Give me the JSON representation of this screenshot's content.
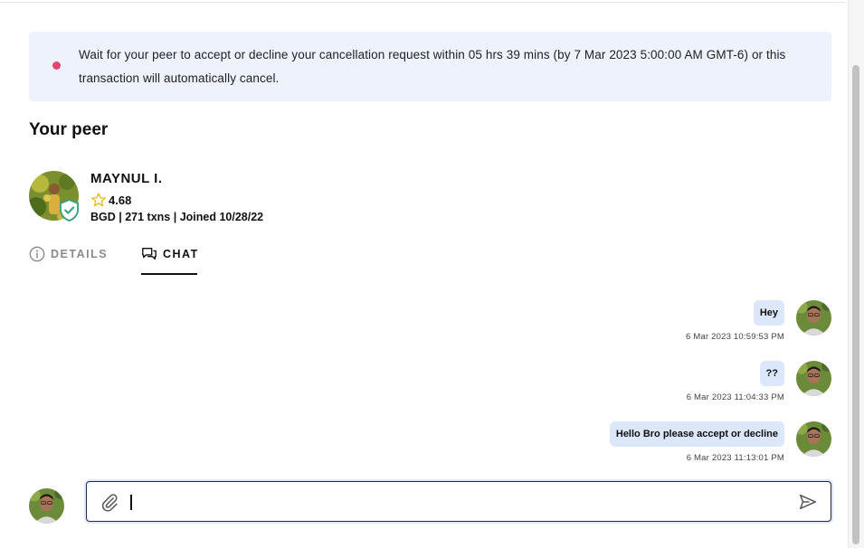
{
  "notice": {
    "text": "Wait for your peer to accept or decline your cancellation request within 05 hrs 39 mins (by 7 Mar 2023 5:00:00 AM GMT-6) or this transaction will automatically cancel.",
    "dot_color": "#e0466e"
  },
  "peer": {
    "heading": "Your peer",
    "name": "MAYNUL I.",
    "rating": "4.68",
    "stats": "BGD | 271 txns | Joined 10/28/22",
    "verified_icon": "shield-check-icon"
  },
  "tabs": [
    {
      "label": "DETAILS",
      "icon": "info-icon",
      "active": false
    },
    {
      "label": "CHAT",
      "icon": "chat-bubbles-icon",
      "active": true
    }
  ],
  "messages": [
    {
      "text": "Hey",
      "time": "6 Mar 2023 10:59:53 PM"
    },
    {
      "text": "??",
      "time": "6 Mar 2023 11:04:33 PM"
    },
    {
      "text": "Hello Bro please accept or decline",
      "time": "6 Mar 2023 11:13:01 PM"
    }
  ],
  "composer": {
    "value": "",
    "placeholder": "",
    "attach_icon": "paperclip-icon",
    "send_icon": "send-icon"
  },
  "colors": {
    "notice_bg": "#edf2fc",
    "bubble_bg": "#dce7fb",
    "accent_dark": "#1f2a44",
    "verified_green": "#3aa17e"
  }
}
